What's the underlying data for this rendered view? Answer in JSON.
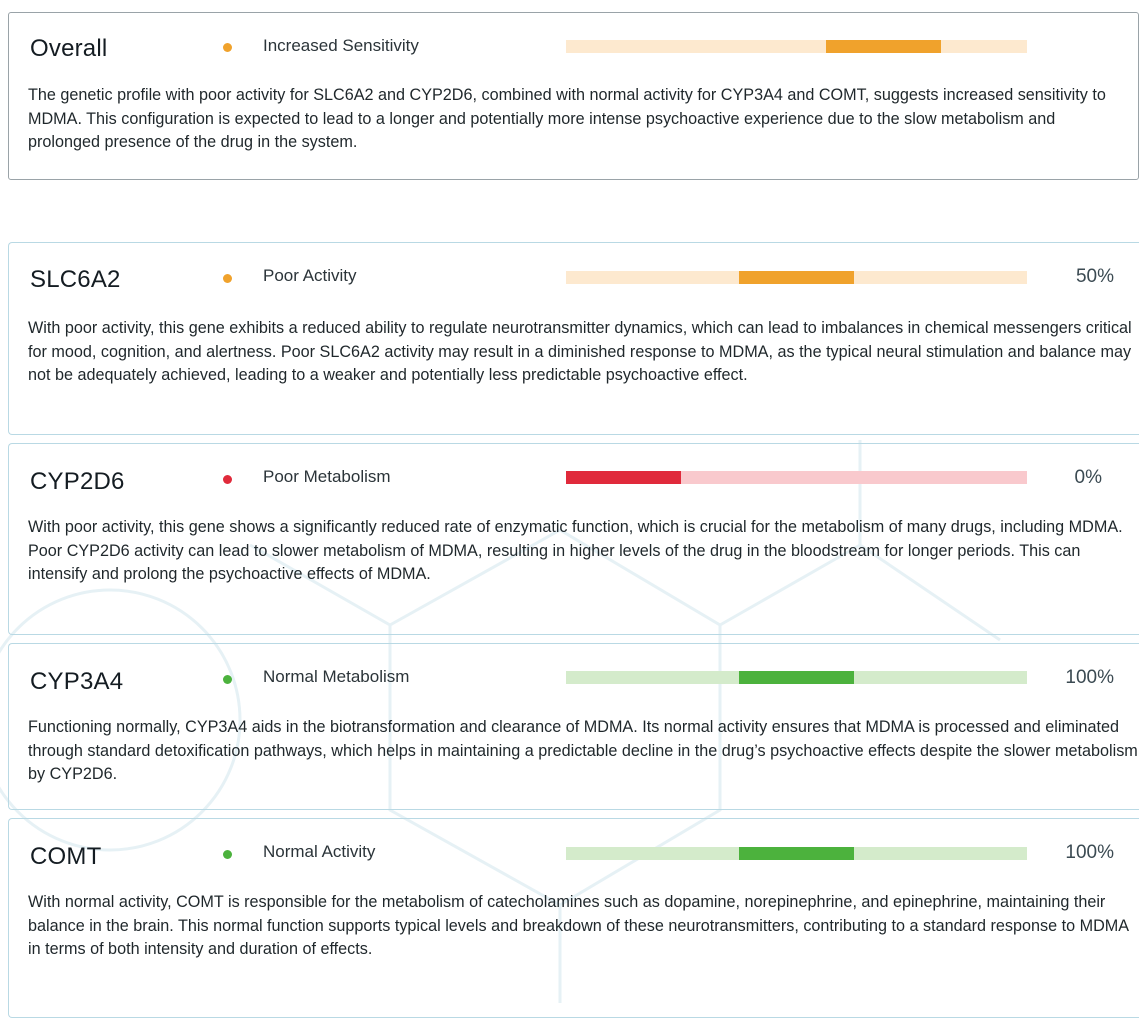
{
  "overall": {
    "title": "Overall",
    "status": "Increased Sensitivity",
    "status_color": "#f0a22c",
    "track_color": "#fde9cf",
    "fill_color": "#f0a22c",
    "level": 0.75,
    "description": "The genetic profile with poor activity for SLC6A2 and CYP2D6, combined with normal activity for CYP3A4 and COMT, suggests increased sensitivity to MDMA. This configuration is expected to lead to a longer and potentially more intense psychoactive experience due to the slow metabolism and prolonged presence of the drug in the system."
  },
  "genes": [
    {
      "name": "SLC6A2",
      "status": "Poor Activity",
      "status_color": "#f0a22c",
      "track_color": "#fde9cf",
      "fill_color": "#f0a22c",
      "percent": "50%",
      "level": 0.5,
      "description": "With poor activity, this gene exhibits a reduced ability to regulate neurotransmitter dynamics, which can lead to imbalances in chemical messengers critical for mood, cognition, and alertness. Poor SLC6A2 activity may result in a diminished response to MDMA, as the typical neural stimulation and balance may not be adequately achieved, leading to a weaker and potentially less predictable psychoactive effect."
    },
    {
      "name": "CYP2D6",
      "status": "Poor Metabolism",
      "status_color": "#e02a3b",
      "track_color": "#f9c9cd",
      "fill_color": "#e02a3b",
      "percent": "0%",
      "level": 0,
      "description": "With poor activity, this gene shows a significantly reduced rate of enzymatic function, which is crucial for the metabolism of many drugs, including MDMA. Poor CYP2D6 activity can lead to slower metabolism of MDMA, resulting in higher levels of the drug in the bloodstream for longer periods. This can intensify and prolong the psychoactive effects of MDMA."
    },
    {
      "name": "CYP3A4",
      "status": "Normal Metabolism",
      "status_color": "#4cb23d",
      "track_color": "#d4ebcb",
      "fill_color": "#4cb23d",
      "percent": "100%",
      "level": 0.5,
      "description": "Functioning normally, CYP3A4 aids in the biotransformation and clearance of MDMA. Its normal activity ensures that MDMA is processed and eliminated through standard detoxification pathways, which helps in maintaining a predictable decline in the drug’s psychoactive effects despite the slower metabolism by CYP2D6."
    },
    {
      "name": "COMT",
      "status": "Normal Activity",
      "status_color": "#4cb23d",
      "track_color": "#d4ebcb",
      "fill_color": "#4cb23d",
      "percent": "100%",
      "level": 0.5,
      "description": "With normal activity, COMT is responsible for the metabolism of catecholamines such as dopamine, norepinephrine, and epinephrine, maintaining their balance in the brain. This normal function supports typical levels and breakdown of these neurotransmitters, contributing to a standard response to MDMA in terms of both intensity and duration of effects."
    }
  ]
}
